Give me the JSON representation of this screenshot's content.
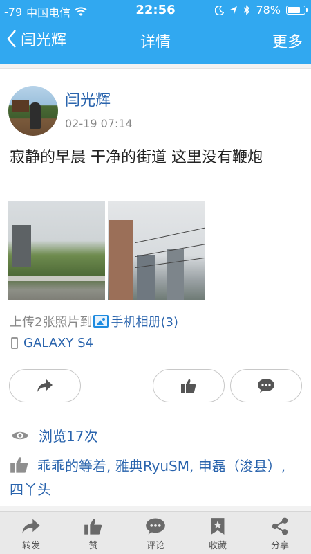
{
  "status_bar": {
    "signal": "-79",
    "carrier": "中国电信",
    "time": "22:56",
    "battery_text": "78%",
    "battery_level": 0.78
  },
  "nav": {
    "back_label": "闫光辉",
    "title": "详情",
    "more_label": "更多"
  },
  "post": {
    "author": "闫光辉",
    "time": "02-19 07:14",
    "content": "寂静的早晨 干净的街道 这里没有鞭炮",
    "upload_prefix": "上传2张照片到",
    "album_label": "手机相册(3)",
    "device": "GALAXY S4"
  },
  "stats": {
    "views": "浏览17次",
    "likers": "乖乖的等着, 雅典RyuSM, 申磊（浚县）, 四丫头"
  },
  "tabbar": {
    "items": [
      {
        "label": "转发",
        "icon": "forward-icon"
      },
      {
        "label": "赞",
        "icon": "thumbs-up-icon"
      },
      {
        "label": "评论",
        "icon": "comment-icon"
      },
      {
        "label": "收藏",
        "icon": "bookmark-icon"
      },
      {
        "label": "分享",
        "icon": "share-icon"
      }
    ]
  },
  "colors": {
    "nav_bg": "#31a8f0",
    "link": "#2a64ad"
  }
}
